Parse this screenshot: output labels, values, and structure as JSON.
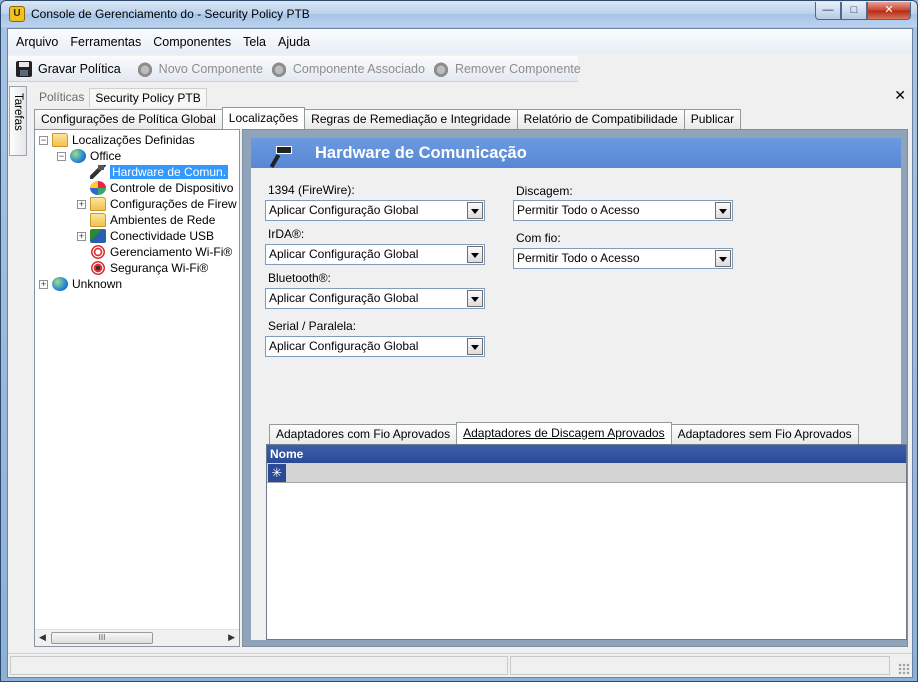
{
  "window": {
    "title": "Console de Gerenciamento do  - Security Policy PTB",
    "app_icon": "shield-icon"
  },
  "menu": [
    "Arquivo",
    "Ferramentas",
    "Componentes",
    "Tela",
    "Ajuda"
  ],
  "toolbar": {
    "save": "Gravar Política",
    "new_component": "Novo Componente",
    "associated_component": "Componente Associado",
    "remove_component": "Remover Componente"
  },
  "side_tab": "Tarefas",
  "breadcrumb": {
    "policies": "Políticas",
    "current": "Security Policy PTB"
  },
  "tabs": [
    "Configurações de Política Global",
    "Localizações",
    "Regras de Remediação e Integridade",
    "Relatório de Compatibilidade",
    "Publicar"
  ],
  "tree": {
    "root": "Localizações Definidas",
    "office": "Office",
    "items": [
      "Hardware de Comun.",
      "Controle de Dispositivo",
      "Configurações de Firew",
      "Ambientes de Rede",
      "Conectividade USB",
      "Gerenciamento Wi-Fi®",
      "Segurança Wi-Fi®"
    ],
    "unknown": "Unknown",
    "scroll_glyph": "III"
  },
  "panel": {
    "title": "Hardware de Comunicação",
    "fields": {
      "firewire": {
        "label": "1394 (FireWire):",
        "value": "Aplicar Configuração Global"
      },
      "irda": {
        "label": "IrDA®:",
        "value": "Aplicar Configuração Global"
      },
      "bluetooth": {
        "label": "Bluetooth®:",
        "value": "Aplicar Configuração Global"
      },
      "serial": {
        "label": "Serial / Paralela:",
        "value": "Aplicar Configuração Global"
      },
      "dialup": {
        "label": "Discagem:",
        "value": "Permitir Todo o Acesso"
      },
      "wired": {
        "label": "Com fio:",
        "value": "Permitir Todo o Acesso"
      }
    },
    "sub_tabs": [
      "Adaptadores com Fio Aprovados",
      "Adaptadores de Discagem Aprovados",
      "Adaptadores sem Fio Aprovados"
    ],
    "grid": {
      "column": "Nome",
      "new_row_marker": "✳"
    }
  },
  "colors": {
    "header_blue": "#5787d5",
    "selection": "#3399ff",
    "grid_header": "#2a4a98"
  }
}
